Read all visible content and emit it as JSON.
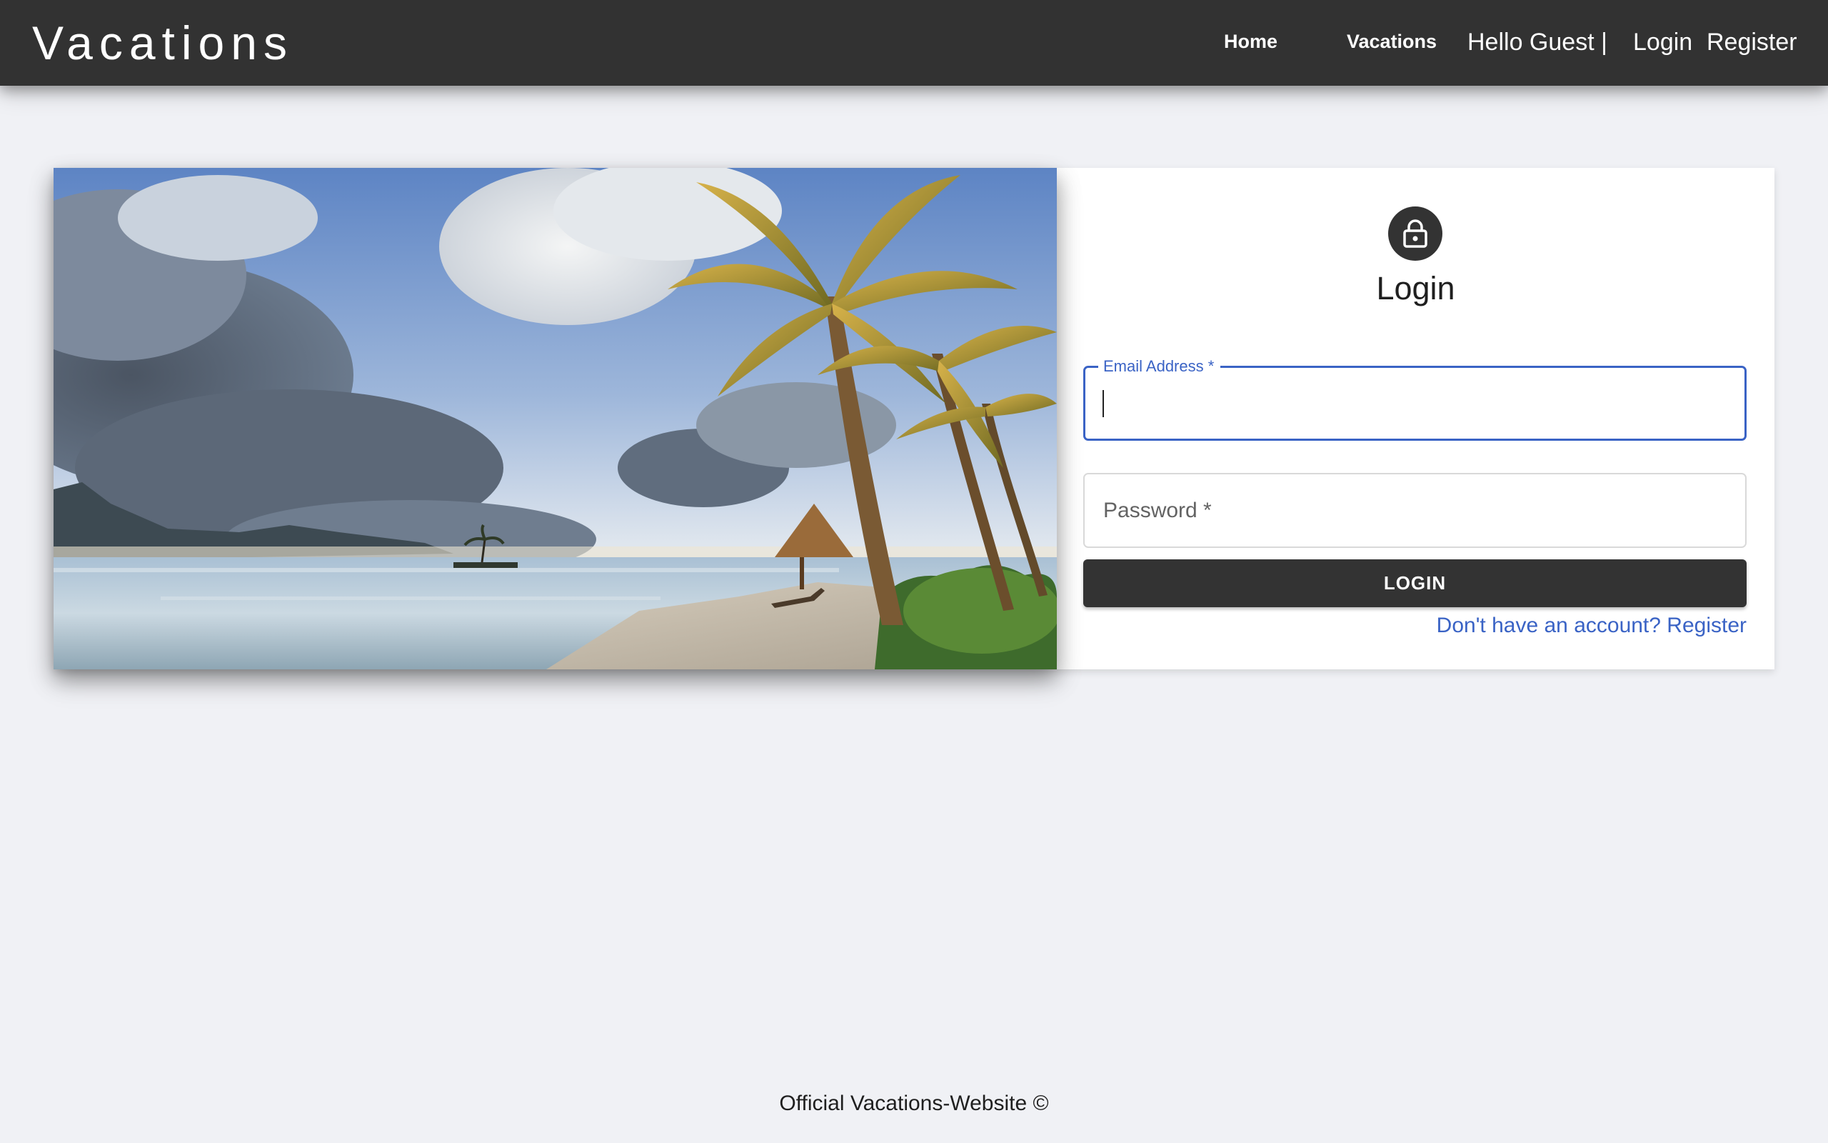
{
  "header": {
    "brand": "Vacations",
    "nav": {
      "home": "Home",
      "vacations": "Vacations"
    },
    "greeting": "Hello Guest |",
    "login": "Login",
    "register": "Register"
  },
  "hero": {
    "icon": "beach-palm-photo"
  },
  "login_form": {
    "icon": "lock-icon",
    "title": "Login",
    "email": {
      "label": "Email Address *",
      "value": ""
    },
    "password": {
      "placeholder": "Password *",
      "value": ""
    },
    "submit": "LOGIN",
    "register_link": "Don't have an account? Register"
  },
  "footer": {
    "text": "Official Vacations-Website ©"
  },
  "colors": {
    "appbar": "#323232",
    "background": "#f0f1f5",
    "accent": "#3a63c5",
    "button": "#333333"
  }
}
